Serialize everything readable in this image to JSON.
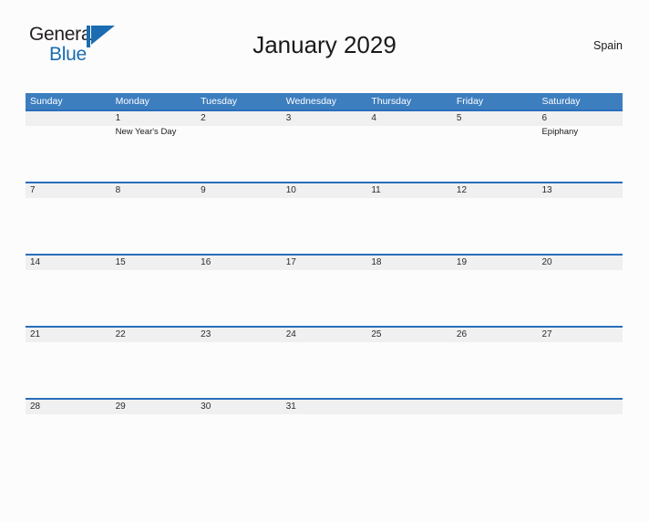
{
  "logo": {
    "word_one": "General",
    "word_two": "Blue",
    "mark_icon": "triangle-flag-icon",
    "accent_color": "#1b6cb0"
  },
  "header": {
    "title": "January 2029",
    "region": "Spain"
  },
  "theme": {
    "header_bar_color": "#3d7ebf",
    "row_border_color": "#2a6ebb",
    "band_color": "#f0f0f0",
    "page_background": "#fcfcfc",
    "text_color": "#1a1a1a"
  },
  "calendar": {
    "month": "January",
    "year": "2029",
    "weekday_headers": [
      "Sunday",
      "Monday",
      "Tuesday",
      "Wednesday",
      "Thursday",
      "Friday",
      "Saturday"
    ],
    "weeks": [
      {
        "days": [
          {
            "num": "",
            "events": []
          },
          {
            "num": "1",
            "events": [
              "New Year's Day"
            ]
          },
          {
            "num": "2",
            "events": []
          },
          {
            "num": "3",
            "events": []
          },
          {
            "num": "4",
            "events": []
          },
          {
            "num": "5",
            "events": []
          },
          {
            "num": "6",
            "events": [
              "Epiphany"
            ]
          }
        ]
      },
      {
        "days": [
          {
            "num": "7",
            "events": []
          },
          {
            "num": "8",
            "events": []
          },
          {
            "num": "9",
            "events": []
          },
          {
            "num": "10",
            "events": []
          },
          {
            "num": "11",
            "events": []
          },
          {
            "num": "12",
            "events": []
          },
          {
            "num": "13",
            "events": []
          }
        ]
      },
      {
        "days": [
          {
            "num": "14",
            "events": []
          },
          {
            "num": "15",
            "events": []
          },
          {
            "num": "16",
            "events": []
          },
          {
            "num": "17",
            "events": []
          },
          {
            "num": "18",
            "events": []
          },
          {
            "num": "19",
            "events": []
          },
          {
            "num": "20",
            "events": []
          }
        ]
      },
      {
        "days": [
          {
            "num": "21",
            "events": []
          },
          {
            "num": "22",
            "events": []
          },
          {
            "num": "23",
            "events": []
          },
          {
            "num": "24",
            "events": []
          },
          {
            "num": "25",
            "events": []
          },
          {
            "num": "26",
            "events": []
          },
          {
            "num": "27",
            "events": []
          }
        ]
      },
      {
        "days": [
          {
            "num": "28",
            "events": []
          },
          {
            "num": "29",
            "events": []
          },
          {
            "num": "30",
            "events": []
          },
          {
            "num": "31",
            "events": []
          },
          {
            "num": "",
            "events": []
          },
          {
            "num": "",
            "events": []
          },
          {
            "num": "",
            "events": []
          }
        ]
      }
    ]
  }
}
